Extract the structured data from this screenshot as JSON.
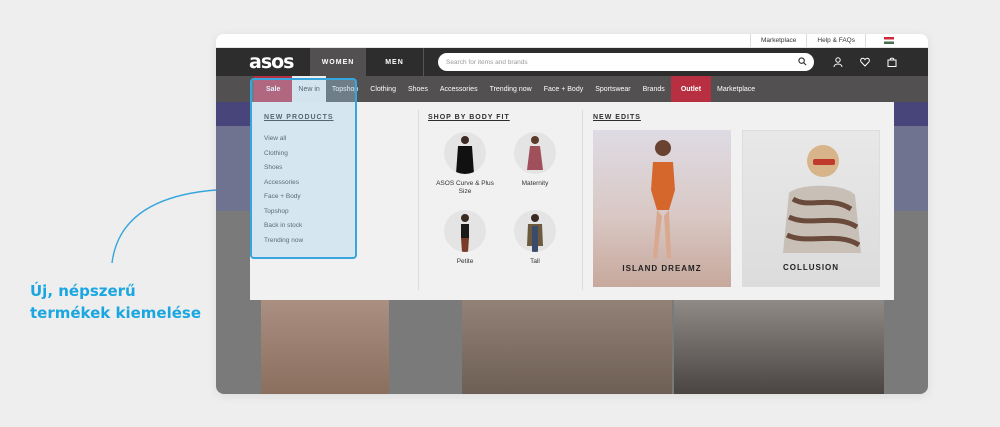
{
  "utility": {
    "marketplace": "Marketplace",
    "help": "Help & FAQs"
  },
  "header": {
    "logo": "asos",
    "women": "WOMEN",
    "men": "MEN",
    "search_placeholder": "Search for items and brands"
  },
  "nav": [
    "Sale",
    "New in",
    "Topshop",
    "Clothing",
    "Shoes",
    "Accessories",
    "Trending now",
    "Face + Body",
    "Sportswear",
    "Brands",
    "Outlet",
    "Marketplace"
  ],
  "new_products": {
    "title": "NEW PRODUCTS",
    "links": [
      "View all",
      "Clothing",
      "Shoes",
      "Accessories",
      "Face + Body",
      "Topshop",
      "Back in stock",
      "Trending now"
    ]
  },
  "shop_by_body_fit": {
    "title": "SHOP BY BODY FIT",
    "items": [
      "ASOS Curve & Plus Size",
      "Maternity",
      "Petite",
      "Tall"
    ]
  },
  "new_edits": {
    "title": "NEW EDITS",
    "cards": [
      "ISLAND DREAMZ",
      "COLLUSION"
    ]
  },
  "annotation": {
    "line1": "Új, népszerű",
    "line2": "termékek kiemelése"
  },
  "colors": {
    "accent": "#38a6de",
    "sale": "#b82f42",
    "dark": "#2d2d2d"
  },
  "icons": [
    "search-icon",
    "account-icon",
    "heart-icon",
    "bag-icon",
    "flag-icon",
    "arrow-icon"
  ]
}
